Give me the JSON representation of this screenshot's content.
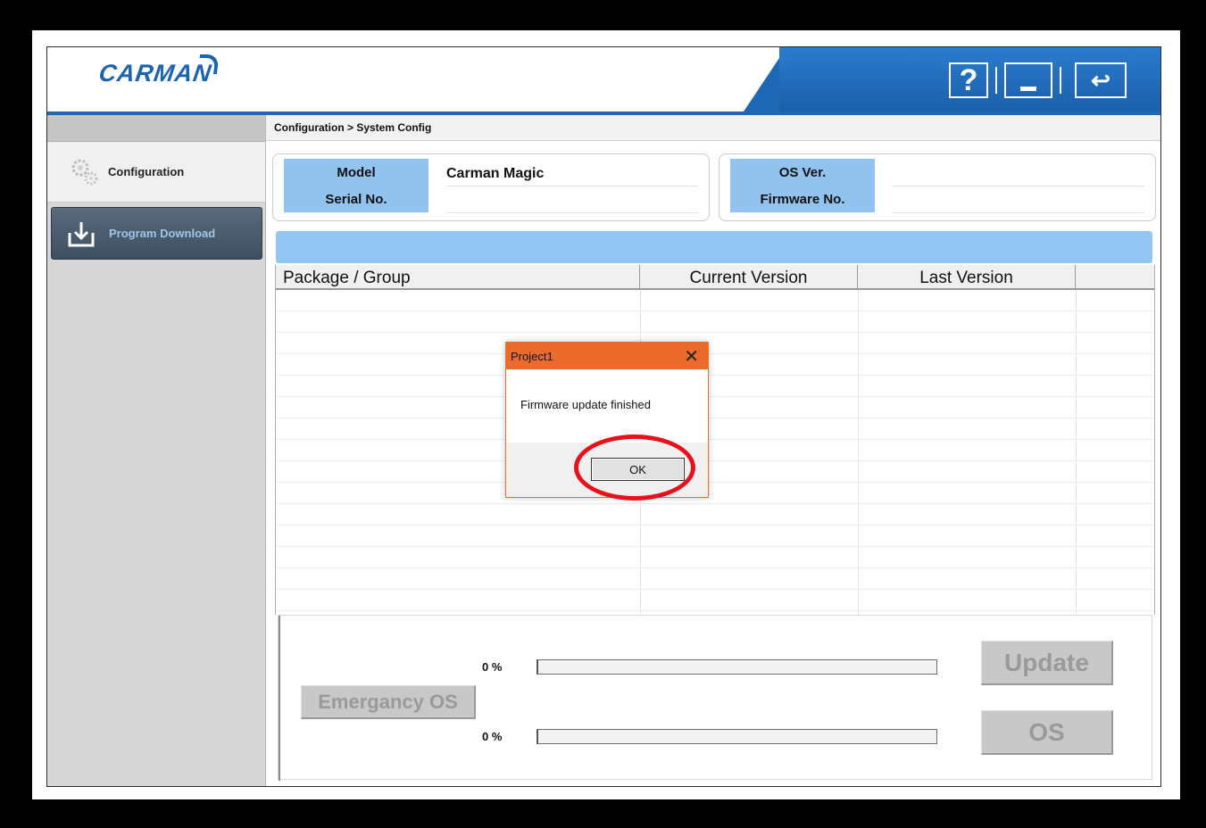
{
  "header": {
    "logo_text": "CARMAN",
    "help_glyph": "?",
    "back_glyph": "↩"
  },
  "sidebar": {
    "items": [
      {
        "label": "Configuration",
        "icon": "gears-icon",
        "active": false
      },
      {
        "label": "Program Download",
        "icon": "download-tray-icon",
        "active": true
      }
    ]
  },
  "breadcrumb": "Configuration > System Config",
  "device_info": {
    "model_label": "Model",
    "model_value": "Carman Magic",
    "serial_label": "Serial No.",
    "serial_value": "",
    "os_label": "OS Ver.",
    "os_value": "",
    "firmware_label": "Firmware No.",
    "firmware_value": ""
  },
  "table": {
    "columns": [
      "Package / Group",
      "Current Version",
      "Last Version",
      ""
    ],
    "rows": []
  },
  "progress": {
    "update_percent_text": "0 %",
    "update_fraction": 0,
    "os_percent_text": "0 %",
    "os_fraction": 0
  },
  "buttons": {
    "emergency": "Emergancy OS",
    "update": "Update",
    "os": "OS"
  },
  "dialog": {
    "title": "Project1",
    "close_glyph": "✕",
    "message": "Firmware update finished",
    "ok_label": "OK"
  },
  "colors": {
    "brand_blue": "#1f68b5",
    "label_blue": "#92c3ee",
    "dialog_accent": "#ea6b2c",
    "highlight_red": "#e8111a"
  }
}
